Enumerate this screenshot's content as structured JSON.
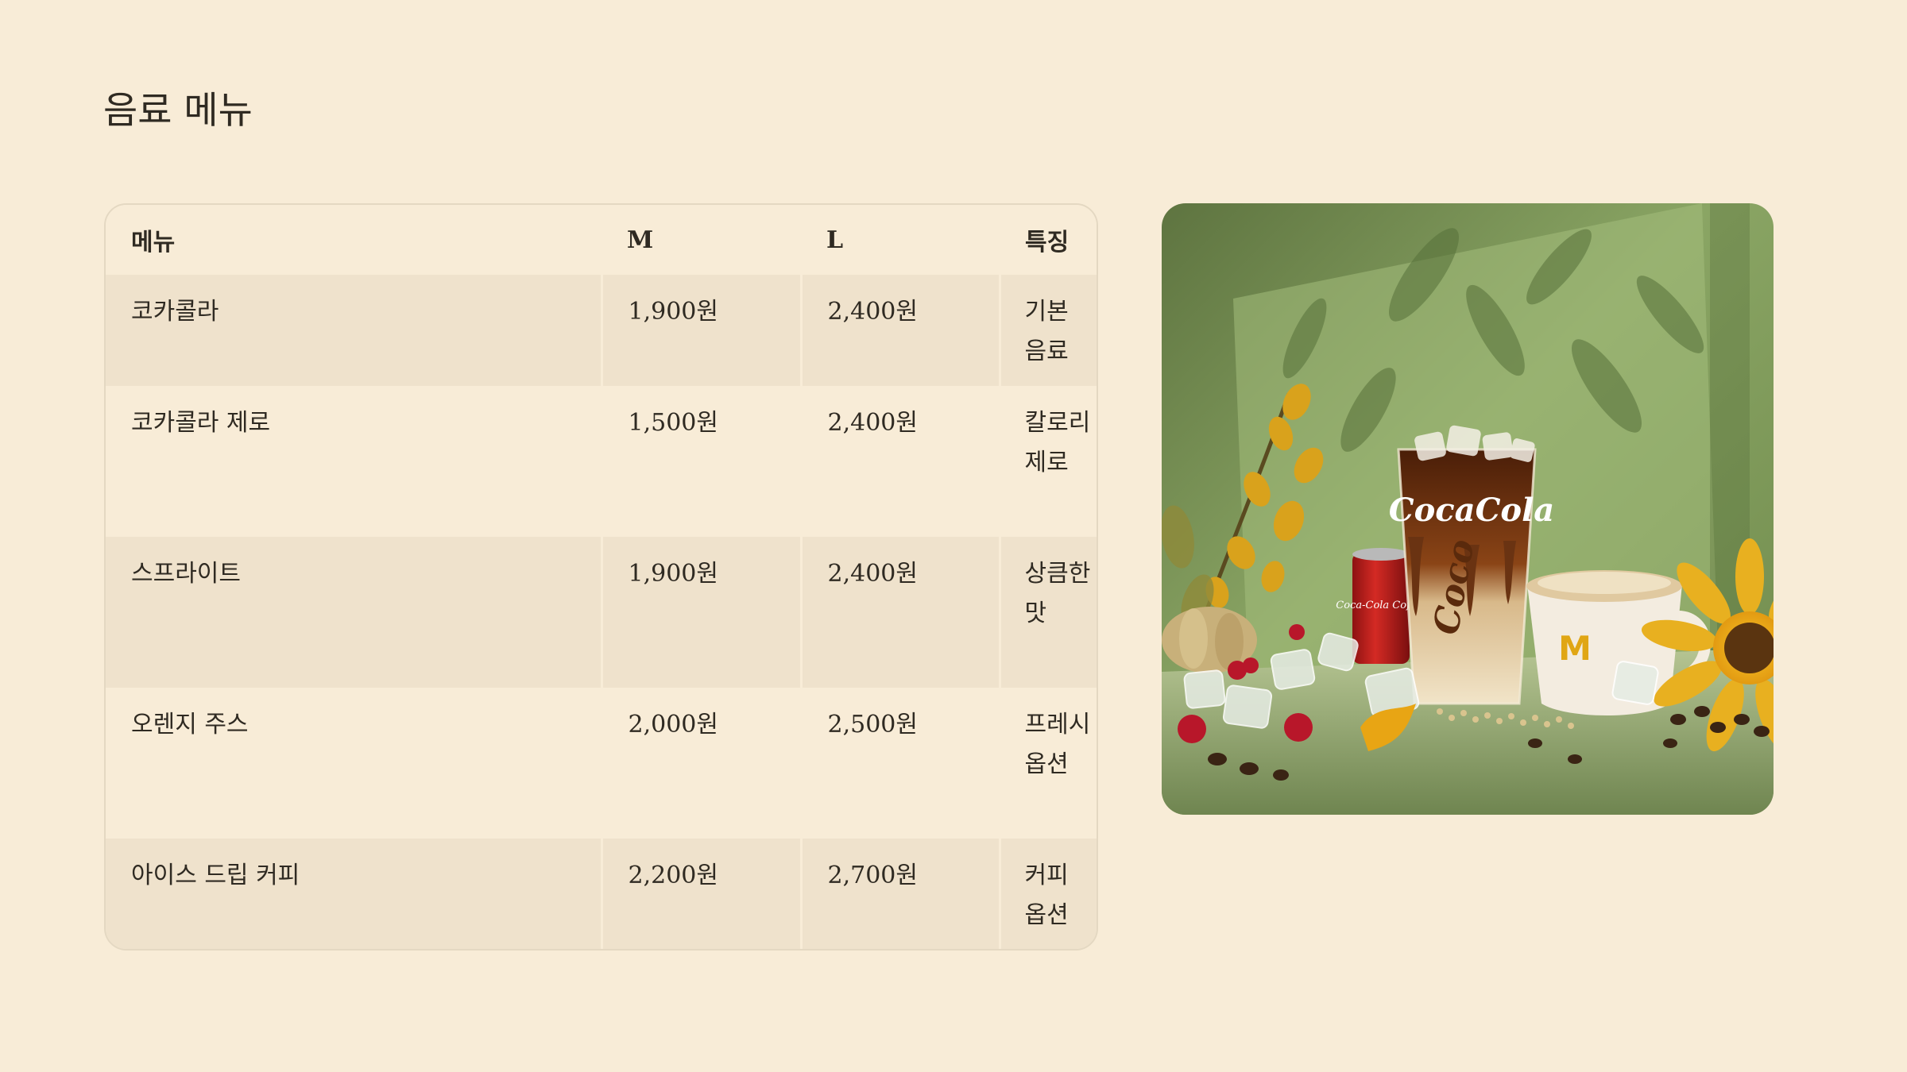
{
  "page": {
    "title": "음료 메뉴"
  },
  "table": {
    "headers": {
      "name": "메뉴",
      "m": "M",
      "l": "L",
      "feature": "특징"
    },
    "rows": [
      {
        "name": "코카콜라",
        "m": "1,900원",
        "l": "2,400원",
        "feature": "기본 음료"
      },
      {
        "name": "코카콜라 제로",
        "m": "1,500원",
        "l": "2,400원",
        "feature": "칼로리 제로"
      },
      {
        "name": "스프라이트",
        "m": "1,900원",
        "l": "2,400원",
        "feature": "상큼한 맛"
      },
      {
        "name": "오렌지 주스",
        "m": "2,000원",
        "l": "2,500원",
        "feature": "프레시 옵션"
      },
      {
        "name": "아이스 드립 커피",
        "m": "2,200원",
        "l": "2,700원",
        "feature": "커피 옵션"
      }
    ]
  },
  "image": {
    "cup_brand": "CocaCola",
    "cup_script": "Coco",
    "can_label": "Coca-Cola Coffee",
    "mug_logo": "M",
    "colors": {
      "background_wall": "#7f9a5a",
      "table_surface": "#a9ba88",
      "coffee": "#6a3312",
      "cream": "#efe1c3",
      "sunflower": "#e8b020",
      "can_red": "#c8201f"
    }
  }
}
